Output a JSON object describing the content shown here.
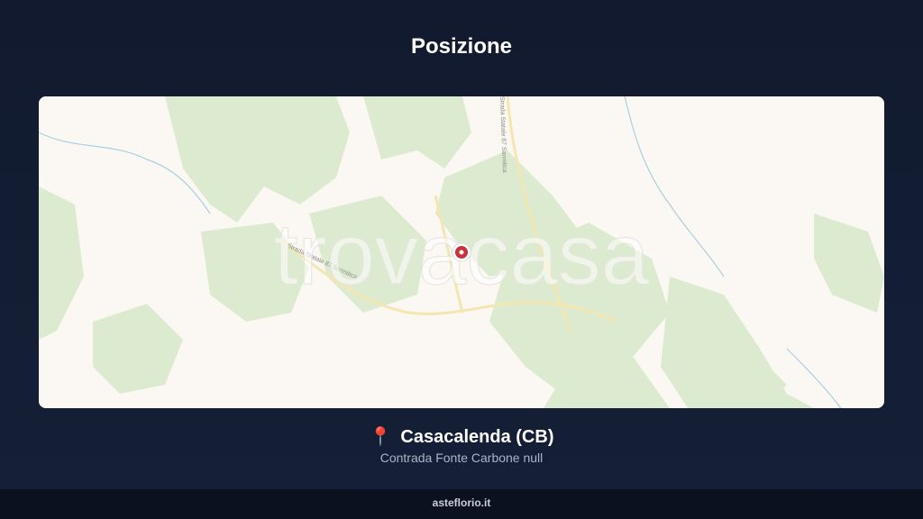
{
  "header": {
    "title": "Posizione"
  },
  "map": {
    "watermark": "trovacasa",
    "roads": [
      "Strada Statale 87 Sannitica",
      "Strada Statale 87 Sannitica"
    ],
    "colors": {
      "land": "#fbf8f3",
      "forest": "#dcebcf",
      "road": "#f3e6b0",
      "marker": "#c8323c"
    }
  },
  "location": {
    "pin_icon": "📍",
    "city": "Casacalenda (CB)",
    "address": "Contrada Fonte Carbone null"
  },
  "footer": {
    "brand": "asteflorio.it"
  }
}
